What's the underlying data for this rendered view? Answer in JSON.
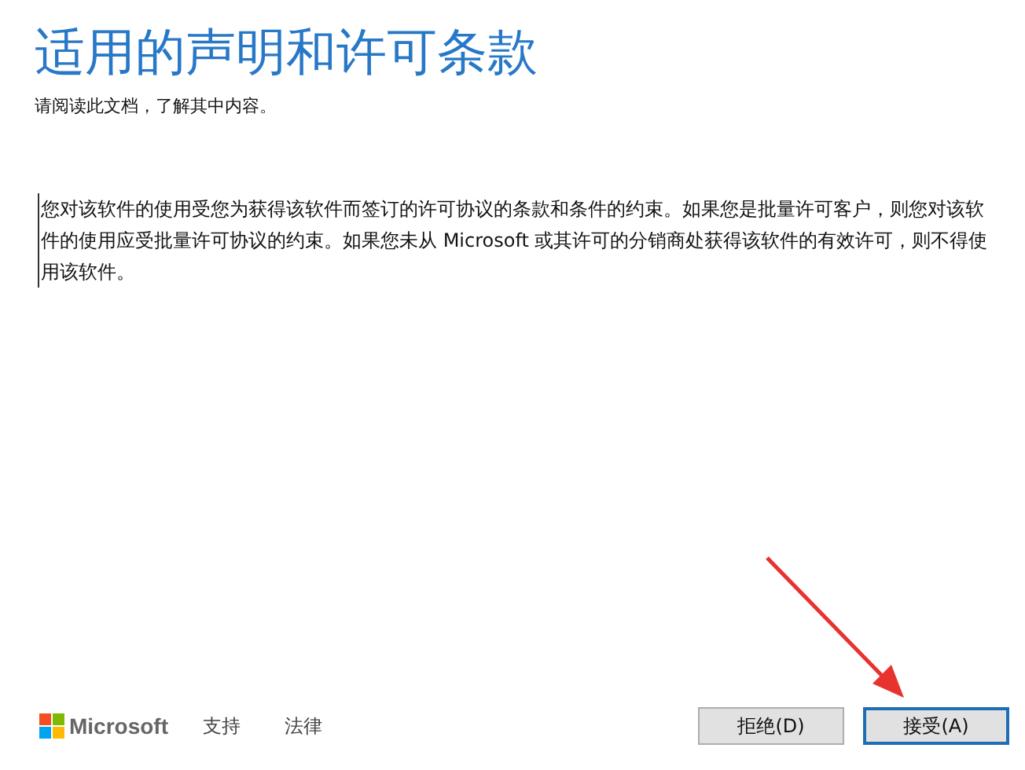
{
  "header": {
    "title": "适用的声明和许可条款",
    "subtitle": "请阅读此文档，了解其中内容。"
  },
  "document": {
    "text": "您对该软件的使用受您为获得该软件而签订的许可协议的条款和条件的约束。如果您是批量许可客户，则您对该软件的使用应受批量许可协议的约束。如果您未从 Microsoft 或其许可的分销商处获得该软件的有效许可，则不得使用该软件。"
  },
  "footer": {
    "brand": "Microsoft",
    "links": [
      "支持",
      "法律"
    ],
    "buttons": [
      {
        "label": "拒绝(D)",
        "focused": false
      },
      {
        "label": "接受(A)",
        "focused": true
      }
    ]
  }
}
